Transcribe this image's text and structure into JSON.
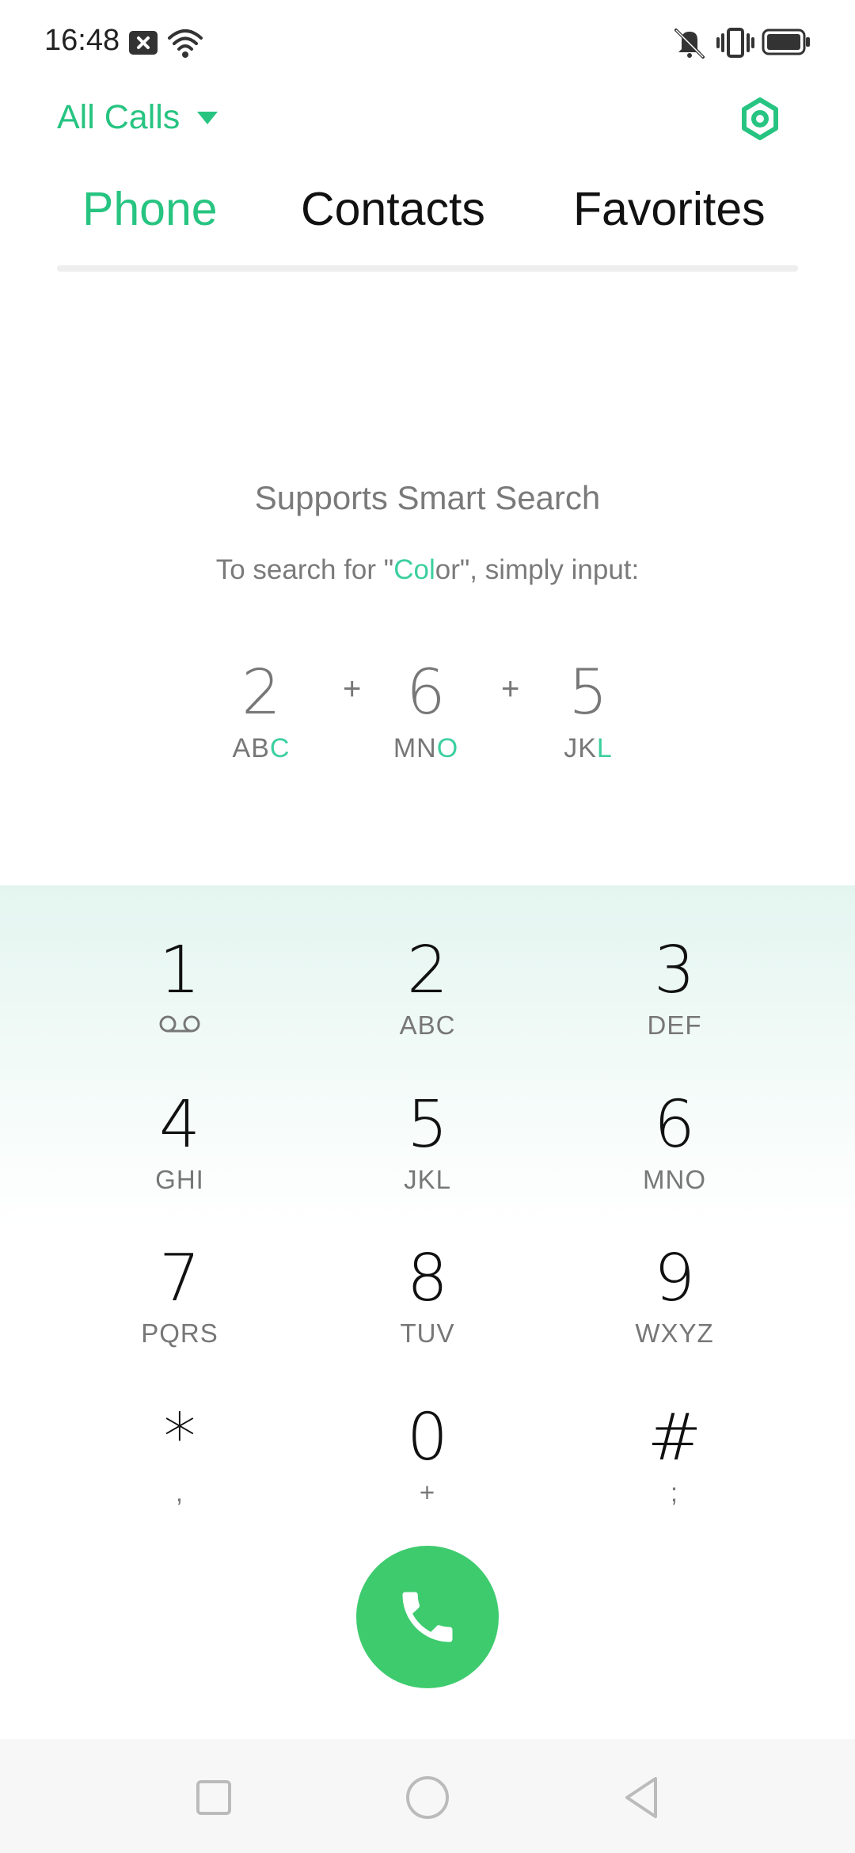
{
  "status_bar": {
    "time": "16:48",
    "icons": [
      "notification-x-icon",
      "wifi-icon",
      "vibrate-off-icon",
      "vibrate-icon",
      "battery-icon"
    ]
  },
  "header": {
    "filter_label": "All Calls",
    "settings_icon": "settings-icon"
  },
  "tabs": [
    {
      "label": "Phone",
      "active": true
    },
    {
      "label": "Contacts",
      "active": false
    },
    {
      "label": "Favorites",
      "active": false
    }
  ],
  "hint": {
    "title": "Supports Smart Search",
    "sub_prefix": "To search for \"",
    "sub_highlight": "Col",
    "sub_rest": "or",
    "sub_suffix": "\", simply input:",
    "plus": "+",
    "example": [
      {
        "digit": "2",
        "letters": "AB",
        "highlight": "C"
      },
      {
        "digit": "6",
        "letters": "MN",
        "highlight": "O"
      },
      {
        "digit": "5",
        "letters": "JK",
        "highlight": "L"
      }
    ]
  },
  "dialpad": {
    "keys": [
      {
        "digit": "1",
        "sub": "",
        "icon": "voicemail-icon"
      },
      {
        "digit": "2",
        "sub": "ABC"
      },
      {
        "digit": "3",
        "sub": "DEF"
      },
      {
        "digit": "4",
        "sub": "GHI"
      },
      {
        "digit": "5",
        "sub": "JKL"
      },
      {
        "digit": "6",
        "sub": "MNO"
      },
      {
        "digit": "7",
        "sub": "PQRS"
      },
      {
        "digit": "8",
        "sub": "TUV"
      },
      {
        "digit": "9",
        "sub": "WXYZ"
      },
      {
        "digit": "*",
        "sub": ","
      },
      {
        "digit": "0",
        "sub": "+"
      },
      {
        "digit": "#",
        "sub": ";"
      }
    ]
  },
  "call_button_icon": "phone-icon",
  "colors": {
    "accent": "#27c481",
    "highlight": "#3ccfa0",
    "call_button": "#3ecb6e",
    "dialpad_top": "#e4f5f0"
  },
  "nav_bar": [
    "recents-square-icon",
    "home-circle-icon",
    "back-triangle-icon"
  ]
}
